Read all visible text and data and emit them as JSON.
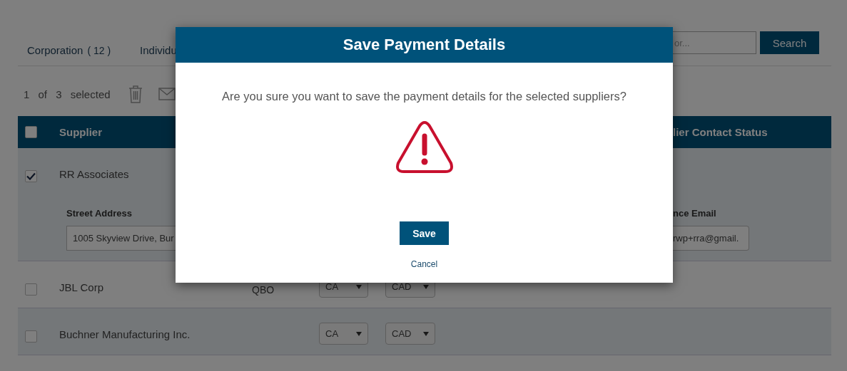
{
  "tabs": [
    {
      "label": "Corporation",
      "count": "( 12 )"
    },
    {
      "label": "Individu"
    }
  ],
  "search": {
    "placeholder": "or...",
    "button": "Search"
  },
  "selection_summary": "1 of 3 selected",
  "table": {
    "select_all_checked": false,
    "columns": [
      "Supplier",
      "lier Contact Status"
    ],
    "rows": [
      {
        "supplier": "RR Associates",
        "checked": true,
        "expanded": true,
        "details": [
          {
            "label": "Street Address",
            "value": "1005 Skyview Drive, Bur"
          },
          {
            "label": "nce Email",
            "value": "rwp+rra@gmail."
          }
        ]
      },
      {
        "supplier": "JBL Corp",
        "checked": false,
        "expanded": false,
        "source": "QBO",
        "country": "CA",
        "currency": "CAD"
      },
      {
        "supplier": "Buchner Manufacturing Inc.",
        "checked": false,
        "expanded": false,
        "country": "CA",
        "currency": "CAD"
      }
    ]
  },
  "dialog": {
    "title": "Save Payment Details",
    "message": "Are you sure you want to save the payment details for the selected suppliers?",
    "confirm": "Save",
    "cancel": "Cancel"
  }
}
